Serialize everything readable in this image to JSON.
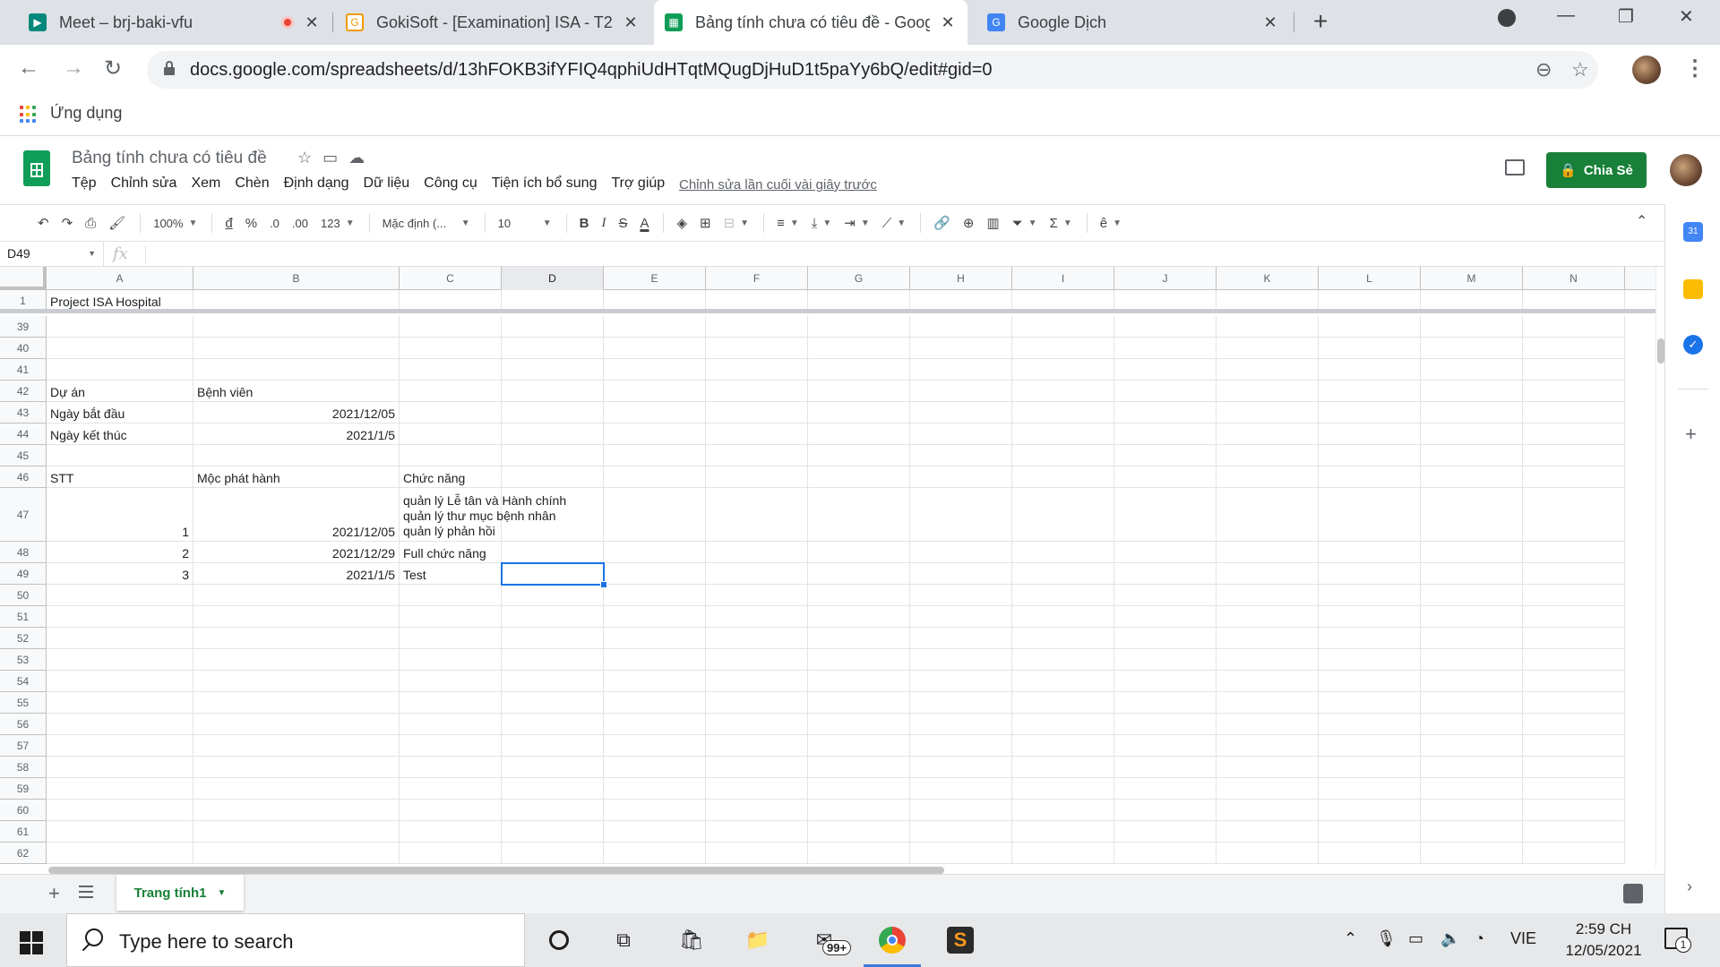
{
  "browser": {
    "tabs": [
      {
        "title": "Meet – brj-baki-vfu",
        "recording": true
      },
      {
        "title": "GokiSoft - [Examination] ISA - T2"
      },
      {
        "title": "Bảng tính chưa có tiêu đề - Goog",
        "active": true
      },
      {
        "title": "Google Dịch"
      }
    ],
    "url": "docs.google.com/spreadsheets/d/13hFOKB3ifYFIQ4qphiUdHTqtMQugDjHuD1t5paYy6bQ/edit#gid=0",
    "bookmarks_label": "Ứng dụng"
  },
  "sheets": {
    "doc_title": "Bảng tính chưa có tiêu đề",
    "menu": [
      "Tệp",
      "Chỉnh sửa",
      "Xem",
      "Chèn",
      "Định dạng",
      "Dữ liệu",
      "Công cụ",
      "Tiện ích bổ sung",
      "Trợ giúp"
    ],
    "last_edit": "Chỉnh sửa lần cuối vài giây trước",
    "share_label": "Chia Sẻ",
    "toolbar": {
      "zoom": "100%",
      "currency": "đ",
      "percent": "%",
      "dec_less": ".0",
      "dec_more": ".00",
      "format_more": "123",
      "font": "Mặc định (...",
      "font_size": "10",
      "bold": "B",
      "italic": "I",
      "strike": "S",
      "text_color": "A"
    },
    "namebox": "D49",
    "fx": "fx",
    "columns": [
      "A",
      "B",
      "C",
      "D",
      "E",
      "F",
      "G",
      "H",
      "I",
      "J",
      "K",
      "L",
      "M",
      "N"
    ],
    "selected_column": "D",
    "rows": [
      {
        "n": "1",
        "cells": {
          "A": "Project ISA Hospital"
        }
      },
      {
        "n": "39",
        "cells": {}
      },
      {
        "n": "40",
        "cells": {}
      },
      {
        "n": "41",
        "cells": {}
      },
      {
        "n": "42",
        "cells": {
          "A": "Dự án",
          "B": "Bệnh viên"
        }
      },
      {
        "n": "43",
        "cells": {
          "A": "Ngày bắt đầu",
          "B": "2021/12/05"
        }
      },
      {
        "n": "44",
        "cells": {
          "A": "Ngày kết thúc",
          "B": "2021/1/5"
        }
      },
      {
        "n": "45",
        "cells": {}
      },
      {
        "n": "46",
        "cells": {
          "A": "STT",
          "B": "Mộc phát hành",
          "C": "Chức năng"
        }
      },
      {
        "n": "47",
        "cells": {
          "A": "1",
          "B": "2021/12/05",
          "C": [
            "quản lý Lễ tân và Hành chính",
            "quản lý thư mục bệnh nhân",
            "quản lý phản hồi"
          ]
        }
      },
      {
        "n": "48",
        "cells": {
          "A": "2",
          "B": "2021/12/29",
          "C": "Full chức năng"
        }
      },
      {
        "n": "49",
        "cells": {
          "A": "3",
          "B": "2021/1/5",
          "C": "Test"
        }
      },
      {
        "n": "50",
        "cells": {}
      },
      {
        "n": "51",
        "cells": {}
      },
      {
        "n": "52",
        "cells": {}
      },
      {
        "n": "53",
        "cells": {}
      },
      {
        "n": "54",
        "cells": {}
      },
      {
        "n": "55",
        "cells": {}
      },
      {
        "n": "56",
        "cells": {}
      },
      {
        "n": "57",
        "cells": {}
      },
      {
        "n": "58",
        "cells": {}
      },
      {
        "n": "59",
        "cells": {}
      },
      {
        "n": "60",
        "cells": {}
      },
      {
        "n": "61",
        "cells": {}
      },
      {
        "n": "62",
        "cells": {}
      }
    ],
    "sheet_tab": "Trang tính1"
  },
  "taskbar": {
    "search_placeholder": "Type here to search",
    "mail_badge": "99+",
    "language": "VIE",
    "time": "2:59 CH",
    "date": "12/05/2021",
    "notification_count": "1"
  },
  "colors": {
    "sheets_green": "#188038",
    "selection_blue": "#1a73e8"
  }
}
